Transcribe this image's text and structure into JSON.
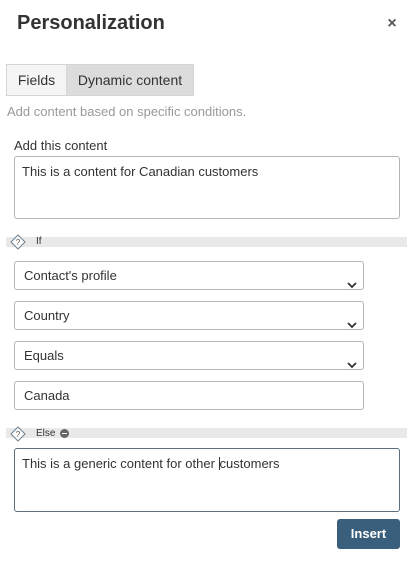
{
  "dialog": {
    "title": "Personalization",
    "close_glyph": "×"
  },
  "tabs": [
    {
      "label": "Fields",
      "active": false
    },
    {
      "label": "Dynamic content",
      "active": true
    }
  ],
  "hint": "Add content based on specific conditions.",
  "add_content": {
    "label": "Add this content",
    "value": "This is a content for Canadian customers"
  },
  "condition": {
    "if_label": "If",
    "field_source": "Contact's profile",
    "field": "Country",
    "operator": "Equals",
    "value": "Canada"
  },
  "else_block": {
    "label": "Else",
    "value_before_cursor": "This is a generic content for other ",
    "value_after_cursor": "customers"
  },
  "insert_button": {
    "label": "Insert"
  },
  "colors": {
    "accent": "#3a5f7d",
    "divider": "#e9e9e9",
    "tab_active": "#dcdcdc"
  },
  "icons": {
    "close": "close-icon",
    "condition": "help-diamond-icon",
    "remove": "minus-circle-icon",
    "dropdown": "chevron-down-icon"
  }
}
